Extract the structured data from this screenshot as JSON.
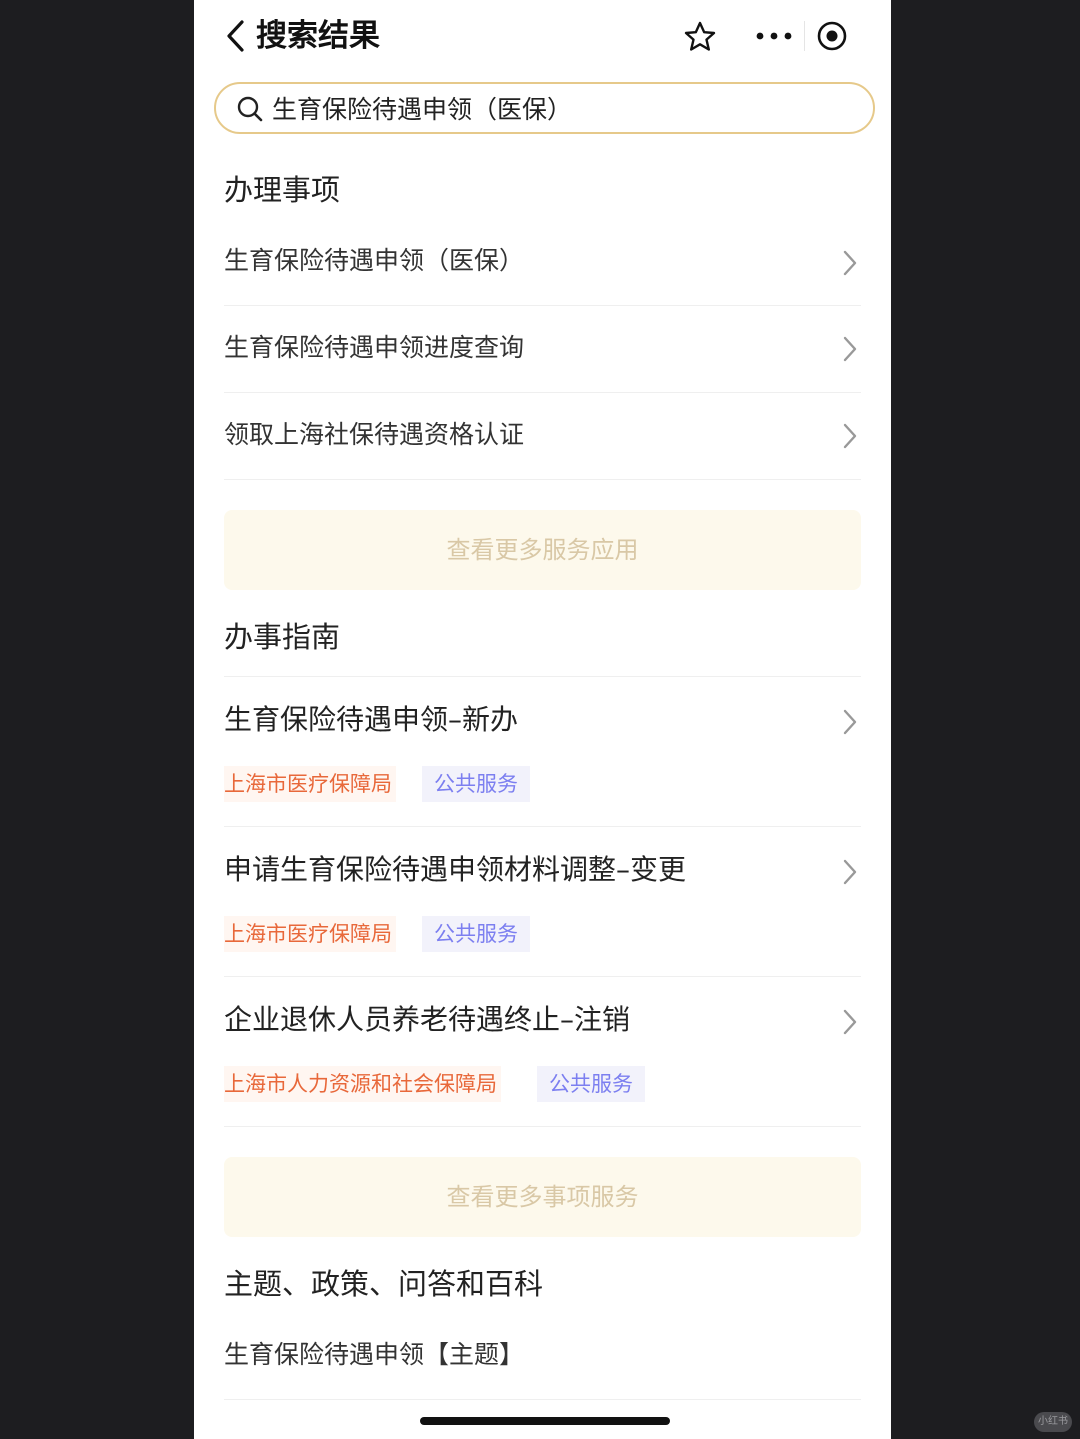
{
  "header": {
    "title": "搜索结果"
  },
  "search": {
    "value": "生育保险待遇申领（医保）"
  },
  "sections": {
    "matters": {
      "title": "办理事项",
      "items": [
        {
          "label": "生育保险待遇申领（医保）"
        },
        {
          "label": "生育保险待遇申领进度查询"
        },
        {
          "label": "领取上海社保待遇资格认证"
        }
      ],
      "more_label": "查看更多服务应用"
    },
    "guides": {
      "title": "办事指南",
      "items": [
        {
          "label": "生育保险待遇申领–新办",
          "org": "上海市医疗保障局",
          "type": "公共服务"
        },
        {
          "label": "申请生育保险待遇申领材料调整–变更",
          "org": "上海市医疗保障局",
          "type": "公共服务"
        },
        {
          "label": "企业退休人员养老待遇终止–注销",
          "org": "上海市人力资源和社会保障局",
          "type": "公共服务"
        }
      ],
      "more_label": "查看更多事项服务"
    },
    "topics": {
      "title": "主题、政策、问答和百科",
      "items": [
        {
          "label": "生育保险待遇申领【主题】"
        }
      ]
    }
  },
  "watermark": "小红书",
  "colors": {
    "accent_border": "#e6c98a",
    "org_tag": "#e8683a",
    "type_tag": "#7c7ff0",
    "more_button_bg": "#fdf9ec"
  }
}
